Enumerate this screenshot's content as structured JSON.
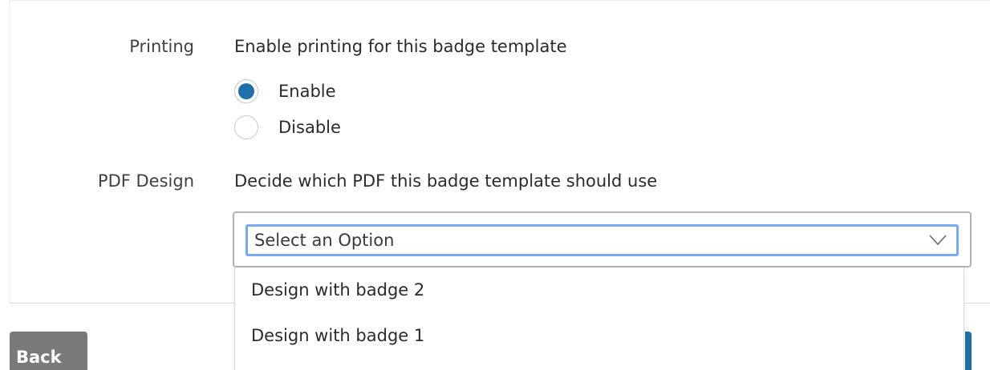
{
  "printing": {
    "label": "Printing",
    "description": "Enable printing for this badge template",
    "options": [
      {
        "label": "Enable",
        "checked": true
      },
      {
        "label": "Disable",
        "checked": false
      }
    ]
  },
  "pdf_design": {
    "label": "PDF Design",
    "description": "Decide which PDF this badge template should use",
    "select": {
      "value": "Select an Option",
      "options": [
        "Design with badge 2",
        "Design with badge 1"
      ]
    }
  },
  "footer": {
    "back_label": "Back"
  },
  "colors": {
    "accent": "#1f6fa8",
    "focus_ring": "#78a9f2",
    "back_button": "#7a7a7a"
  },
  "icons": {
    "select_chevron": "chevron-down-icon"
  }
}
